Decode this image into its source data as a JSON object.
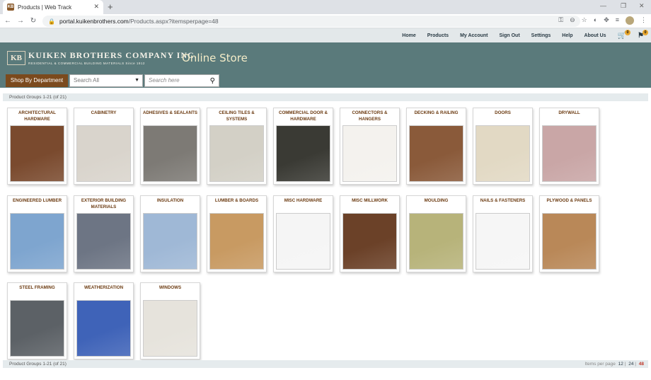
{
  "browser": {
    "tab_title": "Products | Web Track",
    "favicon_text": "KB",
    "url_domain": "portal.kuikenbrothers.com",
    "url_path": "/Products.aspx?itemsperpage=48"
  },
  "nav": {
    "items": [
      "Home",
      "Products",
      "My Account",
      "Sign Out",
      "Settings",
      "Help",
      "About Us"
    ],
    "cart_count": "0",
    "flag_count": "0"
  },
  "header": {
    "logo_mark": "KB",
    "logo_name": "KUIKEN BROTHERS COMPANY INC.",
    "logo_sub": "RESIDENTIAL & COMMERCIAL BUILDING MATERIALS Since 1912",
    "store_title": "Online Store",
    "dept_button": "Shop By Department",
    "search_select": "Search All",
    "search_placeholder": "Search here"
  },
  "info": {
    "groups_label": "Product Groups 1-21 (of 21)",
    "per_page_label": "Items per page",
    "per_page_options": [
      "12",
      "24",
      "48"
    ],
    "per_page_selected": "48"
  },
  "categories": [
    {
      "name": "ARCHITECTURAL HARDWARE",
      "icon": "hardware-display-image",
      "color": "#7a4a2e"
    },
    {
      "name": "CABINETRY",
      "icon": "kitchen-image",
      "color": "#d9d4cc"
    },
    {
      "name": "ADHESIVES & SEALANTS",
      "icon": "caulk-gun-image",
      "color": "#7d7a75"
    },
    {
      "name": "CEILING TILES & SYSTEMS",
      "icon": "ceiling-image",
      "color": "#d3d0c6"
    },
    {
      "name": "COMMERCIAL DOOR & HARDWARE",
      "icon": "commercial-door-image",
      "color": "#3a3a34"
    },
    {
      "name": "CONNECTORS & HANGERS",
      "icon": "hanger-image",
      "color": "#f4f2ee"
    },
    {
      "name": "DECKING & RAILING",
      "icon": "deck-image",
      "color": "#8a5a3a"
    },
    {
      "name": "DOORS",
      "icon": "doors-image",
      "color": "#e2d9c4"
    },
    {
      "name": "DRYWALL",
      "icon": "drywall-image",
      "color": "#c9a6a6"
    },
    {
      "name": "ENGINEERED LUMBER",
      "icon": "lumber-lift-image",
      "color": "#7ea5cf"
    },
    {
      "name": "EXTERIOR BUILDING MATERIALS",
      "icon": "building-image",
      "color": "#6d7584"
    },
    {
      "name": "INSULATION",
      "icon": "insulation-image",
      "color": "#9fb8d6"
    },
    {
      "name": "LUMBER & BOARDS",
      "icon": "boards-image",
      "color": "#c89a62"
    },
    {
      "name": "MISC HARDWARE",
      "icon": "hammer-image",
      "color": "#f5f5f5"
    },
    {
      "name": "MISC MILLWORK",
      "icon": "millwork-image",
      "color": "#6b4128"
    },
    {
      "name": "MOULDING",
      "icon": "moulding-image",
      "color": "#b7b37a"
    },
    {
      "name": "NAILS & FASTENERS",
      "icon": "screw-image",
      "color": "#f6f6f6"
    },
    {
      "name": "PLYWOOD & PANELS",
      "icon": "plywood-image",
      "color": "#b98858"
    },
    {
      "name": "STEEL FRAMING",
      "icon": "steel-truck-image",
      "color": "#5c6166"
    },
    {
      "name": "WEATHERIZATION",
      "icon": "wrapped-building-image",
      "color": "#3f63b8"
    },
    {
      "name": "WINDOWS",
      "icon": "windows-room-image",
      "color": "#e6e3dc"
    }
  ]
}
